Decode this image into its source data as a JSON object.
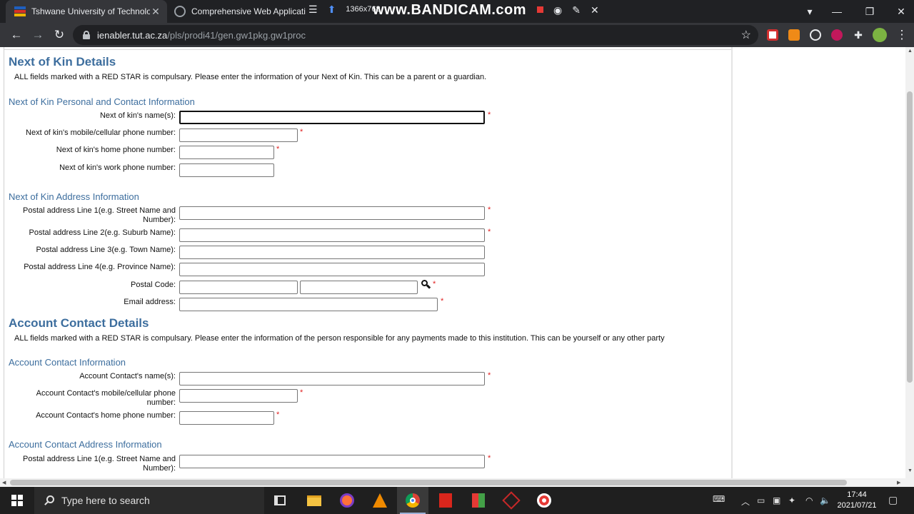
{
  "browser": {
    "tabs": [
      {
        "title": "Tshwane University of Technolog",
        "active": true
      },
      {
        "title": "Comprehensive Web Application",
        "active": false
      }
    ],
    "url_domain": "ienabler.tut.ac.za",
    "url_path": "/pls/prodi41/gen.gw1pkg.gw1proc"
  },
  "recorder": {
    "resolution": "1366x768",
    "brand": "www.BANDICAM.com"
  },
  "page": {
    "next_of_kin": {
      "title": "Next of Kin Details",
      "intro": "ALL fields marked with a RED STAR is compulsary. Please enter the information of your Next of Kin. This can be a parent or a guardian.",
      "personal_section": "Next of Kin Personal and Contact Information",
      "labels": {
        "names": "Next of kin's name(s):",
        "mobile": "Next of kin's mobile/cellular phone number:",
        "home": "Next of kin's home phone number:",
        "work": "Next of kin's work phone number:"
      },
      "address_section": "Next of Kin Address Information",
      "address_labels": {
        "line1": "Postal address Line 1(e.g. Street Name and Number):",
        "line2": "Postal address Line 2(e.g. Suburb Name):",
        "line3": "Postal address Line 3(e.g. Town Name):",
        "line4": "Postal address Line 4(e.g. Province Name):",
        "postal_code": "Postal Code:",
        "email": "Email address:"
      }
    },
    "account_contact": {
      "title": "Account Contact Details",
      "intro": "ALL fields marked with a RED STAR is compulsary. Please enter the information of the person responsible for any payments made to this institution. This can be yourself or any other party",
      "info_section": "Account Contact Information",
      "labels": {
        "names": "Account Contact's name(s):",
        "mobile": "Account Contact's mobile/cellular phone number:",
        "home": "Account Contact's home phone number:"
      },
      "address_section": "Account Contact Address Information",
      "address_labels": {
        "line1": "Postal address Line 1(e.g. Street Name and Number):"
      }
    },
    "required_marker": "*"
  },
  "taskbar": {
    "search_placeholder": "Type here to search",
    "time": "17:44",
    "date": "2021/07/21"
  },
  "colors": {
    "heading": "#3d6e9e",
    "required": "#e02020"
  }
}
